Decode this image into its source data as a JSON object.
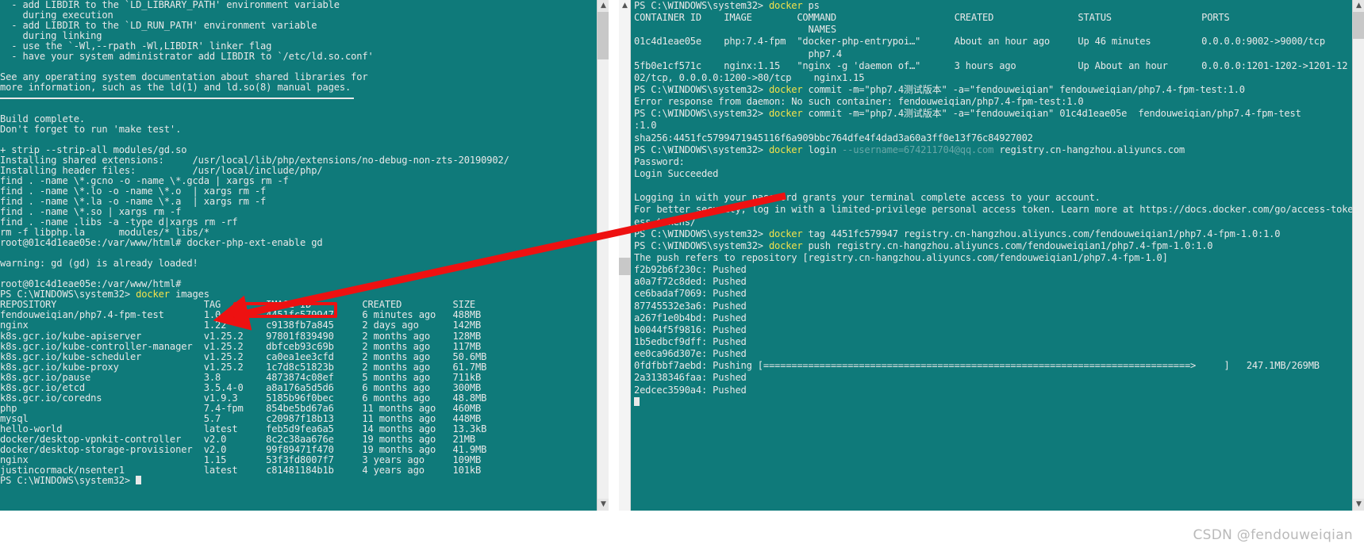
{
  "left_terminal": {
    "name": "php-build-and-docker-images-terminal",
    "background": "#0f7a7a",
    "foreground": "#e8e8e8",
    "lines": [
      "  - add LIBDIR to the `LD_LIBRARY_PATH' environment variable",
      "    during execution",
      "  - add LIBDIR to the `LD_RUN_PATH' environment variable",
      "    during linking",
      "  - use the `-Wl,--rpath -Wl,LIBDIR' linker flag",
      "  - have your system administrator add LIBDIR to `/etc/ld.so.conf'",
      "",
      "See any operating system documentation about shared libraries for",
      "more information, such as the ld(1) and ld.so(8) manual pages.",
      "",
      "",
      "Build complete.",
      "Don't forget to run 'make test'.",
      "",
      "+ strip --strip-all modules/gd.so",
      "Installing shared extensions:     /usr/local/lib/php/extensions/no-debug-non-zts-20190902/",
      "Installing header files:          /usr/local/include/php/",
      "find . -name \\*.gcno -o -name \\*.gcda | xargs rm -f",
      "find . -name \\*.lo -o -name \\*.o  | xargs rm -f",
      "find . -name \\*.la -o -name \\*.a  | xargs rm -f",
      "find . -name \\*.so | xargs rm -f",
      "find . -name .libs -a -type d|xargs rm -rf",
      "rm -f libphp.la      modules/* libs/*",
      "root@01c4d1eae05e:/var/www/html# docker-php-ext-enable gd",
      "",
      "warning: gd (gd) is already loaded!",
      "",
      "root@01c4d1eae05e:/var/www/html#"
    ],
    "prompt_line": {
      "prompt": "PS C:\\WINDOWS\\system32> ",
      "command_keyword": "docker",
      "command_args": " images"
    },
    "images_table": {
      "headers": [
        "REPOSITORY",
        "TAG",
        "IMAGE ID",
        "CREATED",
        "SIZE"
      ],
      "rows": [
        [
          "fendouweiqian/php7.4-fpm-test",
          "1.0",
          "4451fc579947",
          "6 minutes ago",
          "488MB"
        ],
        [
          "nginx",
          "1.22",
          "c9138fb7a845",
          "2 days ago",
          "142MB"
        ],
        [
          "k8s.gcr.io/kube-apiserver",
          "v1.25.2",
          "97801f839490",
          "2 months ago",
          "128MB"
        ],
        [
          "k8s.gcr.io/kube-controller-manager",
          "v1.25.2",
          "dbfceb93c69b",
          "2 months ago",
          "117MB"
        ],
        [
          "k8s.gcr.io/kube-scheduler",
          "v1.25.2",
          "ca0ea1ee3cfd",
          "2 months ago",
          "50.6MB"
        ],
        [
          "k8s.gcr.io/kube-proxy",
          "v1.25.2",
          "1c7d8c51823b",
          "2 months ago",
          "61.7MB"
        ],
        [
          "k8s.gcr.io/pause",
          "3.8",
          "4873874c08ef",
          "5 months ago",
          "711kB"
        ],
        [
          "k8s.gcr.io/etcd",
          "3.5.4-0",
          "a8a176a5d5d6",
          "6 months ago",
          "300MB"
        ],
        [
          "k8s.gcr.io/coredns",
          "v1.9.3",
          "5185b96f0bec",
          "6 months ago",
          "48.8MB"
        ],
        [
          "php",
          "7.4-fpm",
          "854be5bd67a6",
          "11 months ago",
          "460MB"
        ],
        [
          "mysql",
          "5.7",
          "c20987f18b13",
          "11 months ago",
          "448MB"
        ],
        [
          "hello-world",
          "latest",
          "feb5d9fea6a5",
          "14 months ago",
          "13.3kB"
        ],
        [
          "docker/desktop-vpnkit-controller",
          "v2.0",
          "8c2c38aa676e",
          "19 months ago",
          "21MB"
        ],
        [
          "docker/desktop-storage-provisioner",
          "v2.0",
          "99f89471f470",
          "19 months ago",
          "41.9MB"
        ],
        [
          "nginx",
          "1.15",
          "53f3fd8007f7",
          "3 years ago",
          "109MB"
        ],
        [
          "justincormack/nsenter1",
          "latest",
          "c81481184b1b",
          "4 years ago",
          "101kB"
        ]
      ]
    },
    "final_prompt": "PS C:\\WINDOWS\\system32> "
  },
  "right_terminal": {
    "name": "docker-ps-commit-push-terminal",
    "background": "#0f7a7a",
    "foreground": "#e8e8e8",
    "ps_command": {
      "prompt": "PS C:\\WINDOWS\\system32> ",
      "keyword": "docker",
      "args": " ps"
    },
    "ps_table": {
      "headers": [
        "CONTAINER ID",
        "IMAGE",
        "COMMAND",
        "CREATED",
        "STATUS",
        "PORTS"
      ],
      "header_second_line": "NAMES",
      "rows": [
        {
          "container_id": "01c4d1eae05e",
          "image": "php:7.4-fpm",
          "command": "\"docker-php-entrypoi…\"",
          "created": "About an hour ago",
          "status": "Up 46 minutes",
          "ports": "0.0.0.0:9002->9000/tcp",
          "names": "php7.4"
        },
        {
          "container_id": "5fb0e1cf571c",
          "image": "nginx:1.15",
          "command": "\"nginx -g 'daemon of…\"",
          "created": "3 hours ago",
          "status": "Up About an hour",
          "ports": "0.0.0.0:1201-1202->1201-12",
          "ports_wrap": "02/tcp, 0.0.0.0:1200->80/tcp",
          "names": "nginx1.15"
        }
      ]
    },
    "lines": [
      {
        "type": "cmd",
        "prompt": "PS C:\\WINDOWS\\system32> ",
        "keyword": "docker",
        "args": " commit -m=\"php7.4测试版本\" -a=\"fendouweiqian\" fendouweiqian/php7.4-fpm-test:1.0"
      },
      {
        "type": "out",
        "text": "Error response from daemon: No such container: fendouweiqian/php7.4-fpm-test:1.0"
      },
      {
        "type": "cmd",
        "prompt": "PS C:\\WINDOWS\\system32> ",
        "keyword": "docker",
        "args": " commit -m=\"php7.4测试版本\" -a=\"fendouweiqian\" 01c4d1eae05e  fendouweiqian/php7.4-fpm-test"
      },
      {
        "type": "out",
        "text": ":1.0"
      },
      {
        "type": "out",
        "text": "sha256:4451fc5799471945116f6a909bbc764dfe4f4dad3a60a3ff0e13f76c84927002"
      },
      {
        "type": "cmd-login",
        "prompt": "PS C:\\WINDOWS\\system32> ",
        "keyword": "docker",
        "args_pre": " login ",
        "args_dim": "--username=674211704@qq.com",
        "args_post": " registry.cn-hangzhou.aliyuncs.com"
      },
      {
        "type": "out",
        "text": "Password:"
      },
      {
        "type": "out",
        "text": "Login Succeeded"
      },
      {
        "type": "out",
        "text": ""
      },
      {
        "type": "out",
        "text": "Logging in with your password grants your terminal complete access to your account."
      },
      {
        "type": "out",
        "text": "For better security, log in with a limited-privilege personal access token. Learn more at https://docs.docker.com/go/access-tokens/"
      },
      {
        "type": "out",
        "text": "ess-tokens/"
      },
      {
        "type": "cmd",
        "prompt": "PS C:\\WINDOWS\\system32> ",
        "keyword": "docker",
        "args": " tag 4451fc579947 registry.cn-hangzhou.aliyuncs.com/fendouweiqian1/php7.4-fpm-1.0:1.0"
      },
      {
        "type": "cmd",
        "prompt": "PS C:\\WINDOWS\\system32> ",
        "keyword": "docker",
        "args": " push registry.cn-hangzhou.aliyuncs.com/fendouweiqian1/php7.4-fpm-1.0:1.0"
      },
      {
        "type": "out",
        "text": "The push refers to repository [registry.cn-hangzhou.aliyuncs.com/fendouweiqian1/php7.4-fpm-1.0]"
      }
    ],
    "push_layers": [
      {
        "id": "f2b92b6f230c",
        "status": "Pushed"
      },
      {
        "id": "a0a7f72c8ded",
        "status": "Pushed"
      },
      {
        "id": "ce6badaf7069",
        "status": "Pushed"
      },
      {
        "id": "87745532e3a6",
        "status": "Pushed"
      },
      {
        "id": "a267f1e0b4bd",
        "status": "Pushed"
      },
      {
        "id": "b0044f5f9816",
        "status": "Pushed"
      },
      {
        "id": "1b5edbcf9dff",
        "status": "Pushed"
      },
      {
        "id": "ee0ca96d307e",
        "status": "Pushed"
      },
      {
        "id": "0fdfbbf7aebd",
        "status": "Pushing",
        "progress": "247.1MB/269MB"
      },
      {
        "id": "2a3138346faa",
        "status": "Pushed"
      },
      {
        "id": "2edcec3590a4",
        "status": "Pushed"
      }
    ]
  },
  "annotations": {
    "highlight_box_label": "image-id-highlight",
    "arrow_label": "red-arrow-connector",
    "arrow_color": "#ee1111",
    "highlight_color": "#ee1111"
  },
  "watermark": {
    "text": "CSDN @fendouweiqian",
    "color": "#b9b9b9"
  },
  "scrollbars": {
    "left": {
      "up": "▲",
      "down": "▼"
    },
    "right": {
      "up": "▲",
      "down": "▼"
    }
  }
}
